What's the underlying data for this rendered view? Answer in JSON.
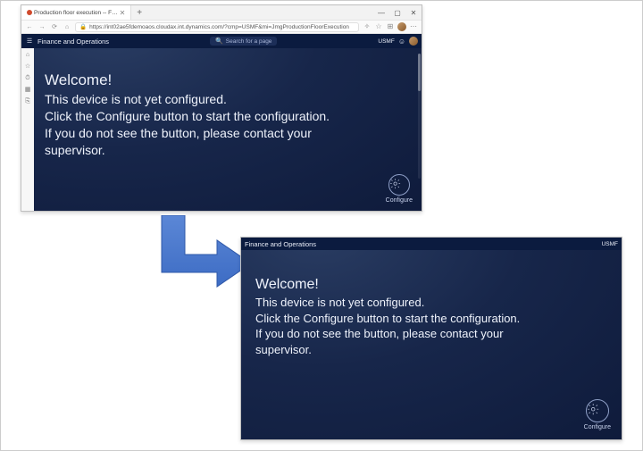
{
  "browser": {
    "tab_title": "Production floor execution -- F…",
    "url": "https://int02ae5fdemoaos.cloudax.int.dynamics.com/?cmp=USMF&mi=JmgProductionFloorExecution",
    "nav": {
      "back": "←",
      "forward": "→",
      "refresh": "⟳",
      "home": "⌂"
    },
    "win": {
      "min": "—",
      "max": "▢",
      "close": "✕"
    },
    "tab_close": "✕",
    "tab_new": "+"
  },
  "fo": {
    "brand": "Finance and Operations",
    "search_placeholder": "Search for a page",
    "company": "USMF"
  },
  "welcome": {
    "heading": "Welcome!",
    "l1": "This device is not yet configured.",
    "l2": "Click the Configure button to start the configuration.",
    "l3": "If you do not see the button, please contact your",
    "l4": "supervisor."
  },
  "configure": {
    "label": "Configure"
  },
  "side": {
    "home": "⌂",
    "star": "☆",
    "clock": "⏱",
    "grid": "▦",
    "link": "⎘"
  }
}
